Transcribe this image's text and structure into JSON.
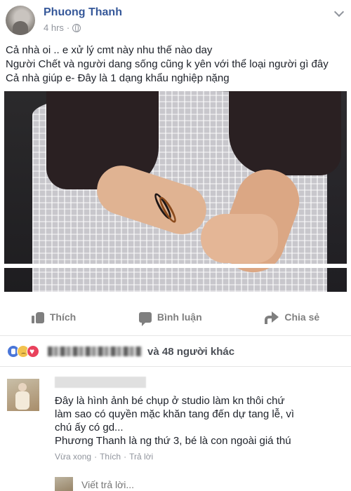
{
  "post": {
    "author": "Phuong Thanh",
    "time": "4 hrs",
    "separator": "·",
    "lines": [
      "Cả nhà oi .. e xử lý cmt này nhu thế nào day",
      "Người Chết và người dang sống cũng k yên với thể loại người gì đây",
      "Cả nhà giúp e- Đây là 1 dạng khẩu nghiệp nặng"
    ]
  },
  "actions": {
    "like": "Thích",
    "comment": "Bình luận",
    "share": "Chia sẻ"
  },
  "reactions": {
    "others_text": "và 48 người khác",
    "icons": [
      "like-icon",
      "sad-icon",
      "love-icon"
    ]
  },
  "comment": {
    "lines": [
      "Đây là hình ảnh bé chụp ở studio làm kn thôi chứ",
      "làm sao có quyền mặc khăn tang đến dự tang lễ, vì",
      "chú ấy có gd...",
      "Phương Thanh là ng thứ 3, bé là con ngoài giá thú"
    ],
    "time": "Vừa xong",
    "like": "Thích",
    "reply": "Trả lời",
    "dot": "·"
  },
  "reply_box": {
    "placeholder": "Viết trả lời..."
  },
  "colors": {
    "name_blue": "#365899",
    "muted": "#90949c",
    "action_gray": "#7f7f7f"
  }
}
